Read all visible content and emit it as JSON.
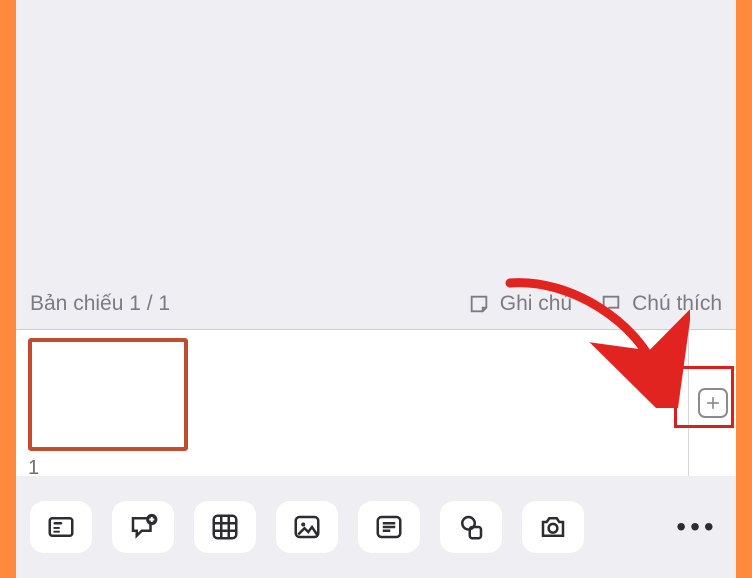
{
  "status": {
    "slide_counter": "Bản chiếu 1 / 1",
    "notes_label": "Ghi chú",
    "annotate_label": "Chú thích"
  },
  "thumbs": {
    "items": [
      {
        "number": "1"
      }
    ]
  },
  "toolbar": {
    "layout_btn": "Layout",
    "comment_btn": "Comment",
    "table_btn": "Table",
    "image_btn": "Image",
    "textbox_btn": "Text Box",
    "shape_btn": "Shape",
    "camera_btn": "Camera",
    "more_btn": "More"
  },
  "add_slide": {
    "label": "+"
  }
}
